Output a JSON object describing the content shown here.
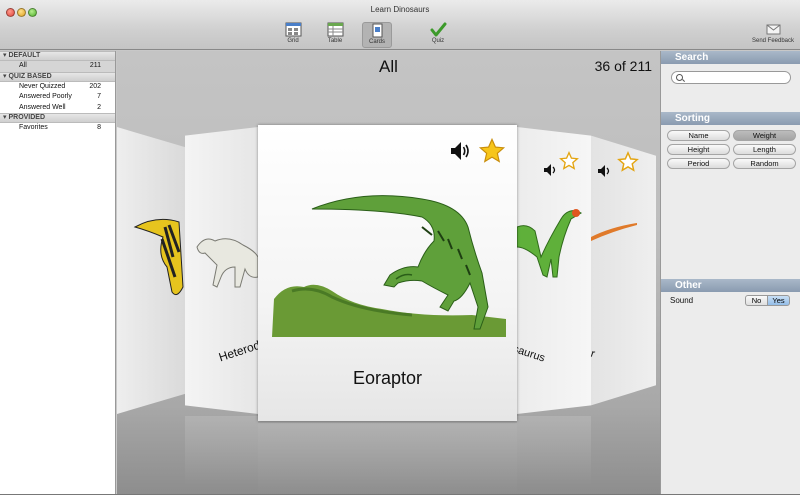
{
  "window": {
    "title": "Learn Dinosaurs"
  },
  "toolbar": {
    "grid": "Grid",
    "table": "Table",
    "cards": "Cards",
    "quiz": "Quiz",
    "feedback": "Send Feedback"
  },
  "sidebar": {
    "groups": [
      {
        "title": "DEFAULT",
        "items": [
          {
            "label": "All",
            "count": "211",
            "selected": true
          }
        ]
      },
      {
        "title": "QUIZ BASED",
        "items": [
          {
            "label": "Never Quizzed",
            "count": "202"
          },
          {
            "label": "Answered Poorly",
            "count": "7"
          },
          {
            "label": "Answered Well",
            "count": "2"
          }
        ]
      },
      {
        "title": "PROVIDED",
        "items": [
          {
            "label": "Favorites",
            "count": "8"
          }
        ]
      }
    ]
  },
  "stage": {
    "title": "All",
    "counter": "36 of 211",
    "center_card": {
      "name": "Eoraptor",
      "favorite": true
    },
    "left_label": "Heterodo",
    "right_label_1": "saurus",
    "right_label_2": "r"
  },
  "panel": {
    "search_title": "Search",
    "search_placeholder": "",
    "sorting_title": "Sorting",
    "sort_options": [
      "Name",
      "Weight",
      "Height",
      "Length",
      "Period",
      "Random"
    ],
    "sort_selected": "Weight",
    "other_title": "Other",
    "sound_label": "Sound",
    "sound_no": "No",
    "sound_yes": "Yes",
    "sound_value": "Yes"
  },
  "colors": {
    "panel_header": "#97a8bc",
    "star": "#f7c51a",
    "dino_green": "#4f9a2a"
  }
}
